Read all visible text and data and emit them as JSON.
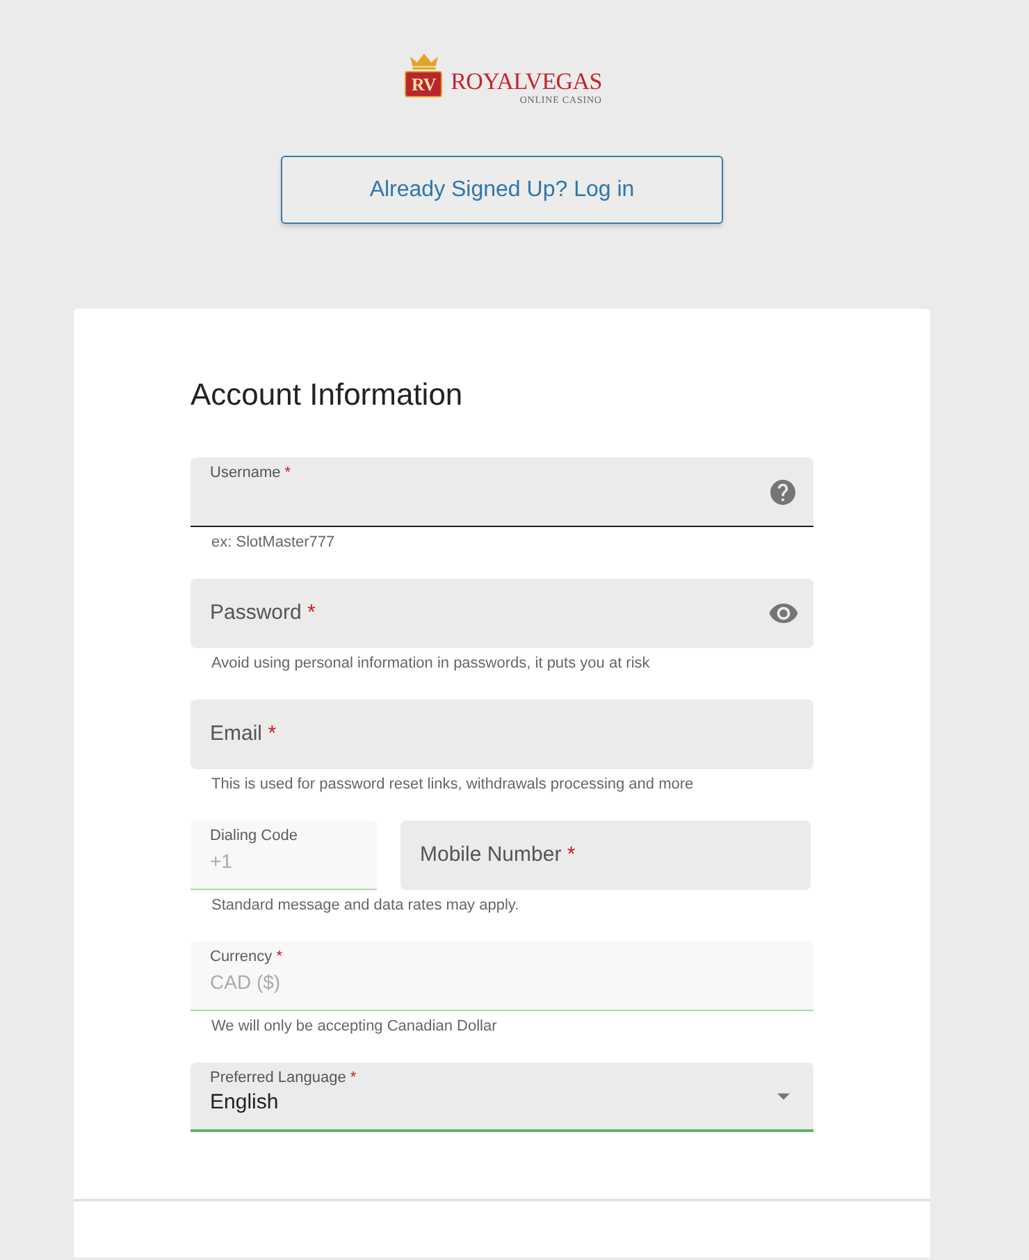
{
  "logo": {
    "badge": "RV",
    "name": "ROYALVEGAS",
    "tagline": "ONLINE CASINO"
  },
  "login_button": {
    "label": "Already Signed Up? Log in"
  },
  "form": {
    "title": "Account Information",
    "groups": [
      {
        "fields": [
          {
            "kind": "text",
            "label": "Username",
            "required_mark": "*",
            "help": true,
            "focused": true,
            "disabled": false
          }
        ],
        "helper_text": "ex: SlotMaster777"
      },
      {
        "fields": [
          {
            "kind": "password",
            "label": "Password",
            "required_mark": "*",
            "help": false,
            "focused": false,
            "disabled": false
          }
        ],
        "helper_text": "Avoid using personal information in passwords, it puts you at risk"
      },
      {
        "fields": [
          {
            "kind": "email",
            "label": "Email",
            "required_mark": "*",
            "help": false,
            "focused": false,
            "disabled": false
          }
        ],
        "helper_text": "This is used for password reset links, withdrawals processing and more"
      },
      {
        "fields": [
          {
            "kind": "code",
            "label": "Dialing Code",
            "value": "+1",
            "help": false,
            "focused": false,
            "disabled": true
          },
          {
            "kind": "tel",
            "label": "Mobile Number",
            "required_mark": "*",
            "help": false,
            "focused": false,
            "disabled": false
          }
        ],
        "helper_text": "Standard message and data rates may apply."
      },
      {
        "fields": [
          {
            "kind": "text",
            "label": "Currency",
            "required_mark": "*",
            "value": "CAD ($)",
            "help": false,
            "focused": false,
            "disabled": true
          }
        ],
        "helper_text": "We will only be accepting Canadian Dollar"
      },
      {
        "fields": [
          {
            "kind": "select",
            "label": "Preferred Language",
            "required_mark": "*",
            "value": "English",
            "help": false,
            "focused": false,
            "disabled": false
          }
        ]
      }
    ]
  }
}
